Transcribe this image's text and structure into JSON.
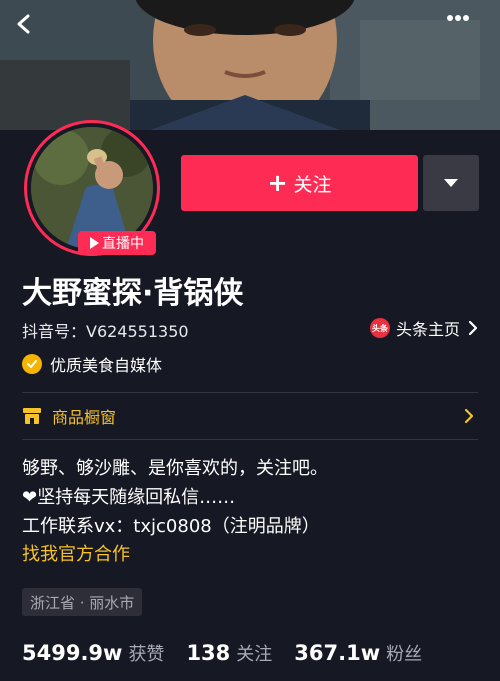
{
  "header": {
    "back_icon": "chevron-left-icon",
    "more_icon": "more-dots-icon"
  },
  "profile": {
    "live_label": "直播中",
    "follow_label": "关注",
    "follow_plus": "+",
    "name": "大野蜜探·背锅侠",
    "account_id": "抖音号：V624551350",
    "toutiao_label": "头条主页",
    "toutiao_logo_text": "头条",
    "verified_label": "优质美食自媒体",
    "shop_label": "商品橱窗"
  },
  "bio": {
    "line1": "够野、够沙雕、是你喜欢的，关注吧。",
    "line2": "❤坚持每天随缘回私信……",
    "line3": "工作联系vx：txjc0808（注明品牌）",
    "official_link": "找我官方合作"
  },
  "location": "浙江省 · 丽水市",
  "stats": [
    {
      "num": "5499.9w",
      "label": "获赞"
    },
    {
      "num": "138",
      "label": "关注"
    },
    {
      "num": "367.1w",
      "label": "粉丝"
    }
  ],
  "colors": {
    "accent": "#fe2c55",
    "gold": "#f5c228",
    "background": "#161823"
  }
}
